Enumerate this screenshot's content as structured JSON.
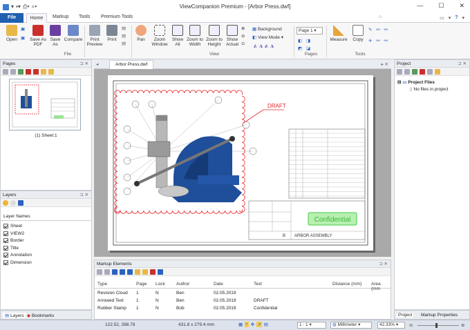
{
  "window": {
    "title": "ViewCompanion Premium - [Arbor Press.dwf]"
  },
  "tabs": {
    "file": "File",
    "home": "Home",
    "markup": "Markup",
    "tools": "Tools",
    "premium": "Premium Tools"
  },
  "ribbon": {
    "open": "Open",
    "save_pdf": "Save As PDF",
    "save_as": "Save As",
    "compare": "Compare",
    "print_preview": "Print Preview",
    "print": "Print",
    "pan": "Pan",
    "zoom_window": "Zoom Window",
    "show_all": "Show All",
    "zoom_width": "Zoom to Width",
    "zoom_height": "Zoom to Height",
    "show_actual": "Show Actual",
    "background": "Background",
    "view_mode": "View Mode",
    "page_select": "Page 1",
    "measure": "Measure",
    "copy": "Copy",
    "group_file": "File",
    "group_view": "View",
    "group_pages": "Pages",
    "group_tools": "Tools"
  },
  "pages_panel": {
    "title": "Pages",
    "sheet_label": "(1) Sheet:1"
  },
  "layers_panel": {
    "title": "Layers",
    "header": "Layer Names",
    "layers": [
      "Sheet",
      "VIEW2",
      "Border",
      "Title",
      "Annotation",
      "Dimension"
    ]
  },
  "left_bottom_tabs": {
    "layers": "Layers",
    "bookmarks": "Bookmarks"
  },
  "document": {
    "tab_name": "Arbor Press.dwf",
    "draft_label": "DRAFT",
    "stamp_label": "Confidential",
    "title_block": "ARBOR ASSEMBLY",
    "sheet_size": "B"
  },
  "project_panel": {
    "title": "Project",
    "root": "Project Files",
    "empty": "No files in project",
    "tab_project": "Project",
    "tab_markup_props": "Markup Properties"
  },
  "markup_panel": {
    "title": "Markup Elements",
    "columns": [
      "Type",
      "Page",
      "Lock",
      "Author",
      "Date",
      "Text",
      "Distance (mm)",
      "Area (mm"
    ],
    "rows": [
      [
        "Revision Cloud",
        "1",
        "N",
        "Ben",
        "02.05.2019",
        "",
        "",
        ""
      ],
      [
        "Arrowed Text",
        "1",
        "N",
        "Ben",
        "02.05.2019",
        "DRAFT",
        "",
        ""
      ],
      [
        "Rubber Stamp",
        "1",
        "N",
        "Bob",
        "02.05.2019",
        "Confidential",
        "",
        ""
      ]
    ]
  },
  "status": {
    "coords": "122.52, 288.78",
    "paper_size": "431.8 x 279.4 mm",
    "scale": "1 : 1",
    "units": "Millimeter",
    "zoom": "42.33%"
  },
  "colors": {
    "file_tab": "#1f5fb0",
    "revision_cloud": "#e8262c",
    "stamp_green": "#5fd35f",
    "press_blue": "#1f4e9a"
  }
}
